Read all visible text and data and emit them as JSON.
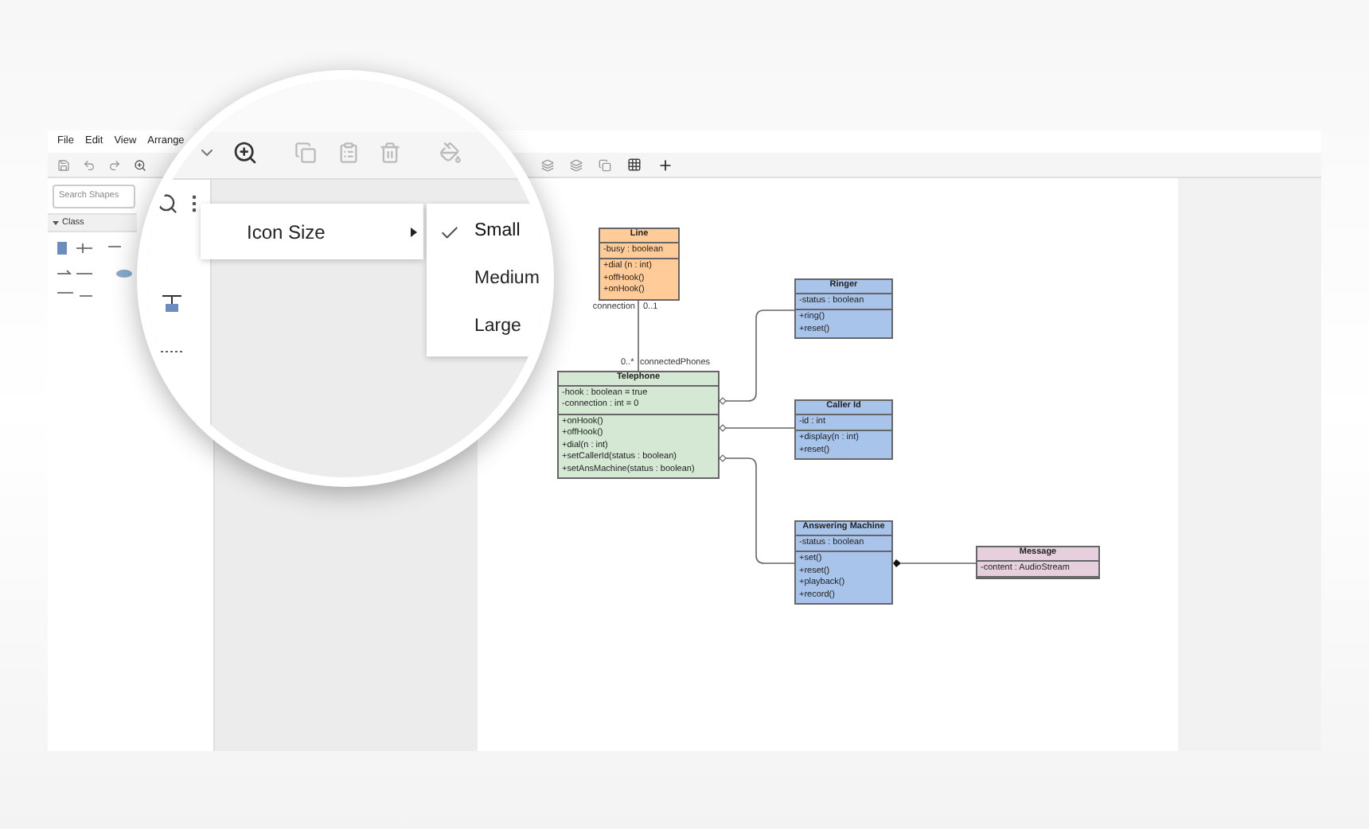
{
  "menu_bar": [
    "File",
    "Edit",
    "View",
    "Arrange"
  ],
  "sidebar": {
    "search": {
      "placeholder": "Search Shapes"
    },
    "section": {
      "title": "Class",
      "expanded": true
    }
  },
  "context_menu": {
    "items": [
      {
        "label": "Icon Size",
        "has_submenu": true
      }
    ]
  },
  "submenu": {
    "items": [
      {
        "label": "Small",
        "selected": true
      },
      {
        "label": "Medium",
        "selected": false
      },
      {
        "label": "Large",
        "selected": false
      }
    ]
  },
  "diagram": {
    "classes": [
      {
        "name": "Line",
        "color": "#ffcc99",
        "attributes": [
          "-busy : boolean"
        ],
        "methods": [
          "+dial (n : int)",
          "+offHook()",
          "+onHook()"
        ]
      },
      {
        "name": "Ringer",
        "color": "#a9c4eb",
        "attributes": [
          "-status : boolean"
        ],
        "methods": [
          "+ring()",
          "+reset()"
        ]
      },
      {
        "name": "Telephone",
        "color": "#d5e8d4",
        "attributes": [
          "-hook : boolean = true",
          "-connection : int = 0"
        ],
        "methods": [
          "+onHook()",
          "+offHook()",
          "+dial(n : int)",
          "+setCallerId(status : boolean)",
          "+setAnsMachine(status : boolean)"
        ]
      },
      {
        "name": "Caller Id",
        "color": "#a9c4eb",
        "attributes": [
          "-id : int"
        ],
        "methods": [
          "+display(n : int)",
          "+reset()"
        ]
      },
      {
        "name": "Answering Machine",
        "color": "#a9c4eb",
        "attributes": [
          "-status : boolean"
        ],
        "methods": [
          "+set()",
          "+reset()",
          "+playback()",
          "+record()"
        ]
      },
      {
        "name": "Message",
        "color": "#e6d0de",
        "attributes": [
          "-content : AudioStream"
        ]
      }
    ],
    "labels": [
      "connection",
      "0..1",
      "0..*",
      "connectedPhones"
    ]
  }
}
